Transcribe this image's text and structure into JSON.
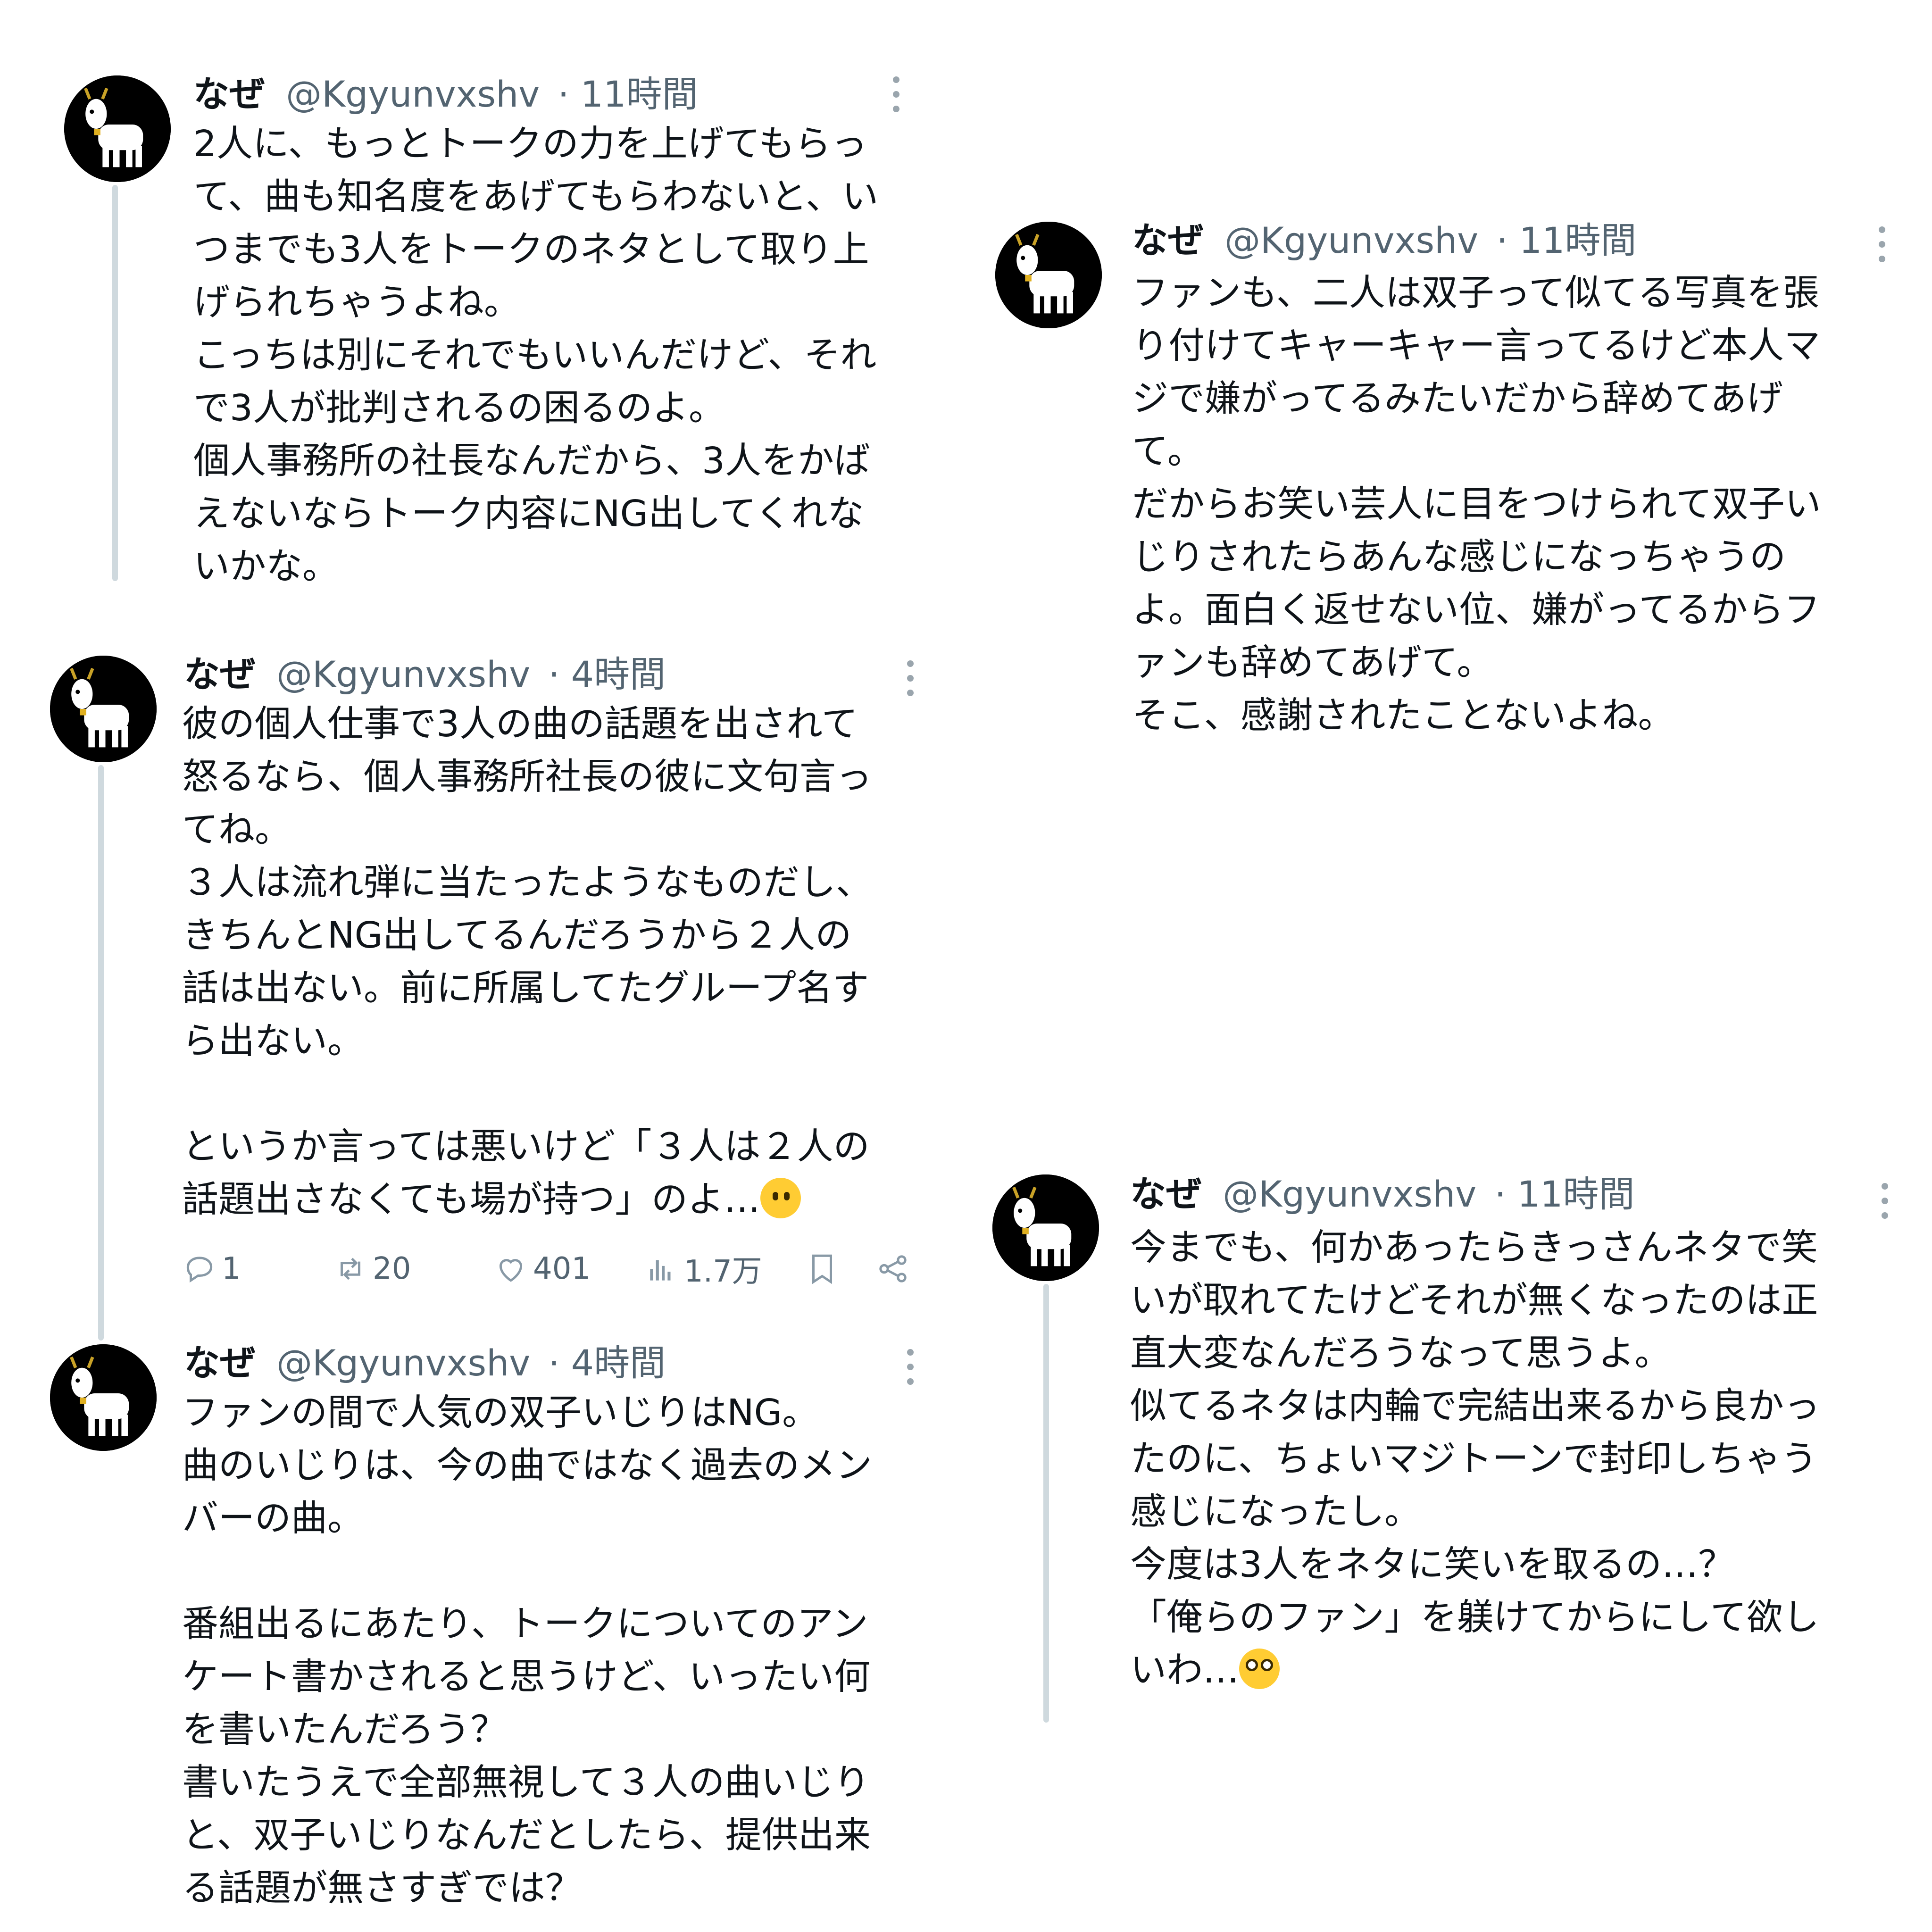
{
  "posts": [
    {
      "name": "なぜ",
      "handle": "@Kgyunvxshv",
      "time": "· 11時間",
      "lines": [
        "2人に、もっとトークの力を上げてもらっ",
        "て、曲も知名度をあげてもらわないと、い",
        "つまでも3人をトークのネタとして取り上",
        "げられちゃうよね。",
        "こっちは別にそれでもいいんだけど、それ",
        "で3人が批判されるの困るのよ。",
        "個人事務所の社長なんだから、3人をかば",
        "えないならトーク内容にNG出してくれな",
        "いかな。"
      ]
    },
    {
      "name": "なぜ",
      "handle": "@Kgyunvxshv",
      "time": "· 4時間",
      "lines": [
        "彼の個人仕事で3人の曲の話題を出されて",
        "怒るなら、個人事務所社長の彼に文句言っ",
        "てね。",
        "３人は流れ弾に当たったようなものだし、",
        "きちんとNG出してるんだろうから２人の",
        "話は出ない。前に所属してたグループ名す",
        "ら出ない。",
        "",
        "というか言っては悪いけど「３人は２人の",
        "話題出さなくても場が持つ」のよ…"
      ],
      "emoji": "melting-face-emoji",
      "actions": {
        "reply": "1",
        "repost": "20",
        "like": "401",
        "views": "1.7万"
      }
    },
    {
      "name": "なぜ",
      "handle": "@Kgyunvxshv",
      "time": "· 4時間",
      "lines": [
        "ファンの間で人気の双子いじりはNG。",
        "曲のいじりは、今の曲ではなく過去のメン",
        "バーの曲。",
        "",
        "番組出るにあたり、トークについてのアン",
        "ケート書かされると思うけど、いったい何",
        "を書いたんだろう？",
        "書いたうえで全部無視して３人の曲いじり",
        "と、双子いじりなんだとしたら、提供出来",
        "る話題が無さすぎでは？"
      ]
    },
    {
      "name": "なぜ",
      "handle": "@Kgyunvxshv",
      "time": "· 11時間",
      "lines": [
        "ファンも、二人は双子って似てる写真を張",
        "り付けてキャーキャー言ってるけど本人マ",
        "ジで嫌がってるみたいだから辞めてあげ",
        "て。",
        "だからお笑い芸人に目をつけられて双子い",
        "じりされたらあんな感じになっちゃうの",
        "よ。面白く返せない位、嫌がってるからフ",
        "ァンも辞めてあげて。",
        "そこ、感謝されたことないよね。"
      ]
    },
    {
      "name": "なぜ",
      "handle": "@Kgyunvxshv",
      "time": "· 11時間",
      "lines": [
        "今までも、何かあったらきっさんネタで笑",
        "いが取れてたけどそれが無くなったのは正",
        "直大変なんだろうなって思うよ。",
        "似てるネタは内輪で完結出来るから良かっ",
        "たのに、ちょいマジトーンで封印しちゃう",
        "感じになったし。",
        "今度は3人をネタに笑いを取るの…？",
        "「俺らのファン」を躾けてからにして欲し",
        "いわ…"
      ],
      "emoji": "flushed-face-emoji"
    }
  ]
}
